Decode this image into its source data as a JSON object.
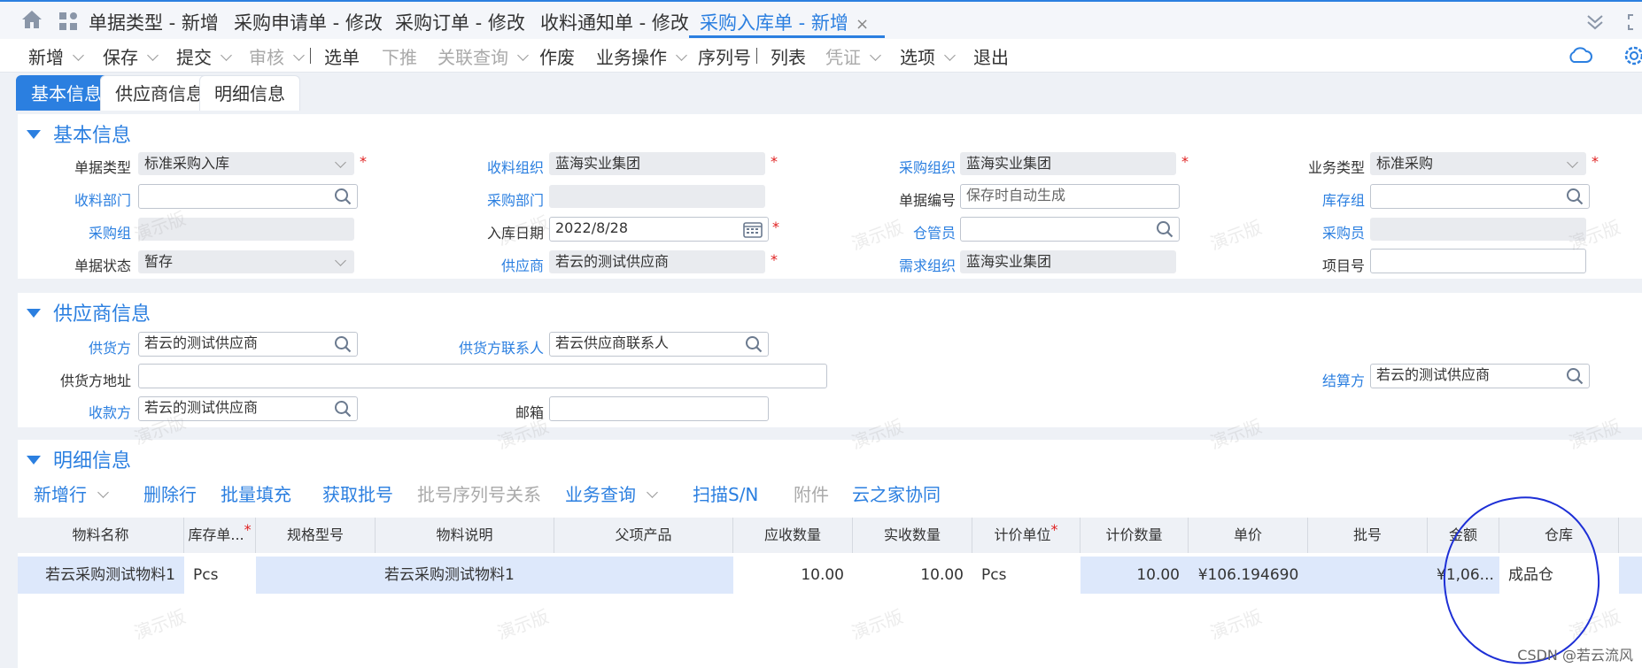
{
  "tabs": [
    {
      "label": "单据类型 - 新增",
      "active": false
    },
    {
      "label": "采购申请单 - 修改",
      "active": false
    },
    {
      "label": "采购订单 - 修改",
      "active": false
    },
    {
      "label": "收料通知单 - 修改",
      "active": false
    },
    {
      "label": "采购入库单 - 新增",
      "active": true
    }
  ],
  "tab_close": "×",
  "toolbar": {
    "new": "新增",
    "save": "保存",
    "submit": "提交",
    "audit": "审核",
    "select": "选单",
    "push": "下推",
    "related": "关联查询",
    "void": "作废",
    "biz": "业务操作",
    "serial": "序列号",
    "list": "列表",
    "voucher": "凭证",
    "options": "选项",
    "exit": "退出"
  },
  "subtabs": [
    "基本信息",
    "供应商信息",
    "明细信息"
  ],
  "basic": {
    "title": "基本信息",
    "doc_type_label": "单据类型",
    "doc_type": "标准采购入库",
    "recv_org_label": "收料组织",
    "recv_org": "蓝海实业集团",
    "pur_org_label": "采购组织",
    "pur_org": "蓝海实业集团",
    "biz_type_label": "业务类型",
    "biz_type": "标准采购",
    "recv_dept_label": "收料部门",
    "pur_dept_label": "采购部门",
    "doc_no_label": "单据编号",
    "doc_no_placeholder": "保存时自动生成",
    "stock_group_label": "库存组",
    "pur_group_label": "采购组",
    "in_date_label": "入库日期",
    "in_date": "2022/8/28",
    "keeper_label": "仓管员",
    "buyer_label": "采购员",
    "status_label": "单据状态",
    "status": "暂存",
    "supplier_label": "供应商",
    "supplier": "若云的测试供应商",
    "demand_org_label": "需求组织",
    "demand_org": "蓝海实业集团",
    "project_label": "项目号"
  },
  "supplier": {
    "title": "供应商信息",
    "supply_label": "供货方",
    "supply": "若云的测试供应商",
    "contact_label": "供货方联系人",
    "contact": "若云供应商联系人",
    "address_label": "供货方地址",
    "settle_label": "结算方",
    "settle": "若云的测试供应商",
    "payee_label": "收款方",
    "payee": "若云的测试供应商",
    "email_label": "邮箱"
  },
  "detail": {
    "title": "明细信息",
    "toolbar": {
      "add_row": "新增行",
      "del_row": "删除行",
      "batch_fill": "批量填充",
      "get_lot": "获取批号",
      "lot_serial": "批号序列号关系",
      "biz_query": "业务查询",
      "scan": "扫描S/N",
      "attach": "附件",
      "cloud": "云之家协同"
    },
    "columns": [
      "物料名称",
      "库存单...",
      "规格型号",
      "物料说明",
      "父项产品",
      "应收数量",
      "实收数量",
      "计价单位",
      "计价数量",
      "单价",
      "批号",
      "金额",
      "仓库"
    ],
    "row": {
      "name": "若云采购测试物料1",
      "unit": "Pcs",
      "spec": "",
      "desc": "若云采购测试物料1",
      "parent": "",
      "due_qty": "10.00",
      "real_qty": "10.00",
      "price_unit": "Pcs",
      "price_qty": "10.00",
      "price": "¥106.194690",
      "lot": "",
      "amount": "¥1,06...",
      "warehouse": "成品仓"
    }
  },
  "watermark": "演示版",
  "csdn": "CSDN @若云流风",
  "required_mark": "*",
  "colors": {
    "accent": "#2b7fe0",
    "required": "#e02020",
    "annotation": "#1d2fd6"
  }
}
